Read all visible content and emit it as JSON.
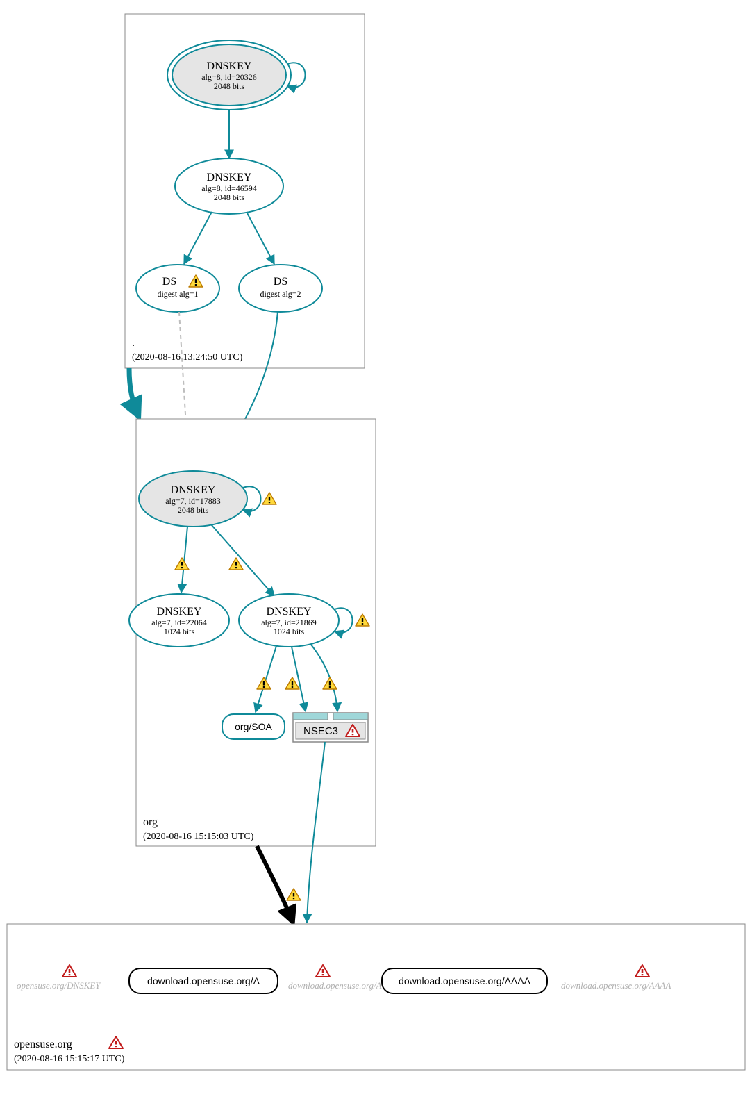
{
  "colors": {
    "teal": "#0f8a99",
    "tealFill": "#0f8a99",
    "gray": "#888888",
    "lightGray": "#bdbdbd",
    "nodeFillGray": "#e5e5e5",
    "nodeFillWhite": "#ffffff",
    "nsecFill": "#9fd7d9",
    "errorRed": "#c11b1b",
    "warnFill": "#ffd93b",
    "warnStroke": "#bb7a00"
  },
  "zones": {
    "root": {
      "label": ".",
      "timestamp": "(2020-08-16 13:24:50 UTC)"
    },
    "org": {
      "label": "org",
      "timestamp": "(2020-08-16 15:15:03 UTC)"
    },
    "opensuse": {
      "label": "opensuse.org",
      "timestamp": "(2020-08-16 15:15:17 UTC)"
    }
  },
  "nodes": {
    "root_ksk": {
      "title": "DNSKEY",
      "sub1": "alg=8, id=20326",
      "sub2": "2048 bits"
    },
    "root_zsk": {
      "title": "DNSKEY",
      "sub1": "alg=8, id=46594",
      "sub2": "2048 bits"
    },
    "ds1": {
      "title": "DS",
      "sub1": "digest alg=1"
    },
    "ds2": {
      "title": "DS",
      "sub1": "digest alg=2"
    },
    "org_ksk": {
      "title": "DNSKEY",
      "sub1": "alg=7, id=17883",
      "sub2": "2048 bits"
    },
    "org_zsk1": {
      "title": "DNSKEY",
      "sub1": "alg=7, id=22064",
      "sub2": "1024 bits"
    },
    "org_zsk2": {
      "title": "DNSKEY",
      "sub1": "alg=7, id=21869",
      "sub2": "1024 bits"
    },
    "org_soa": {
      "title": "org/SOA"
    },
    "nsec3": {
      "title": "NSEC3"
    }
  },
  "bottom": {
    "item1": "opensuse.org/DNSKEY",
    "item2": "download.opensuse.org/A",
    "item3": "download.opensuse.org/A",
    "item4": "download.opensuse.org/AAAA",
    "item5": "download.opensuse.org/AAAA"
  }
}
